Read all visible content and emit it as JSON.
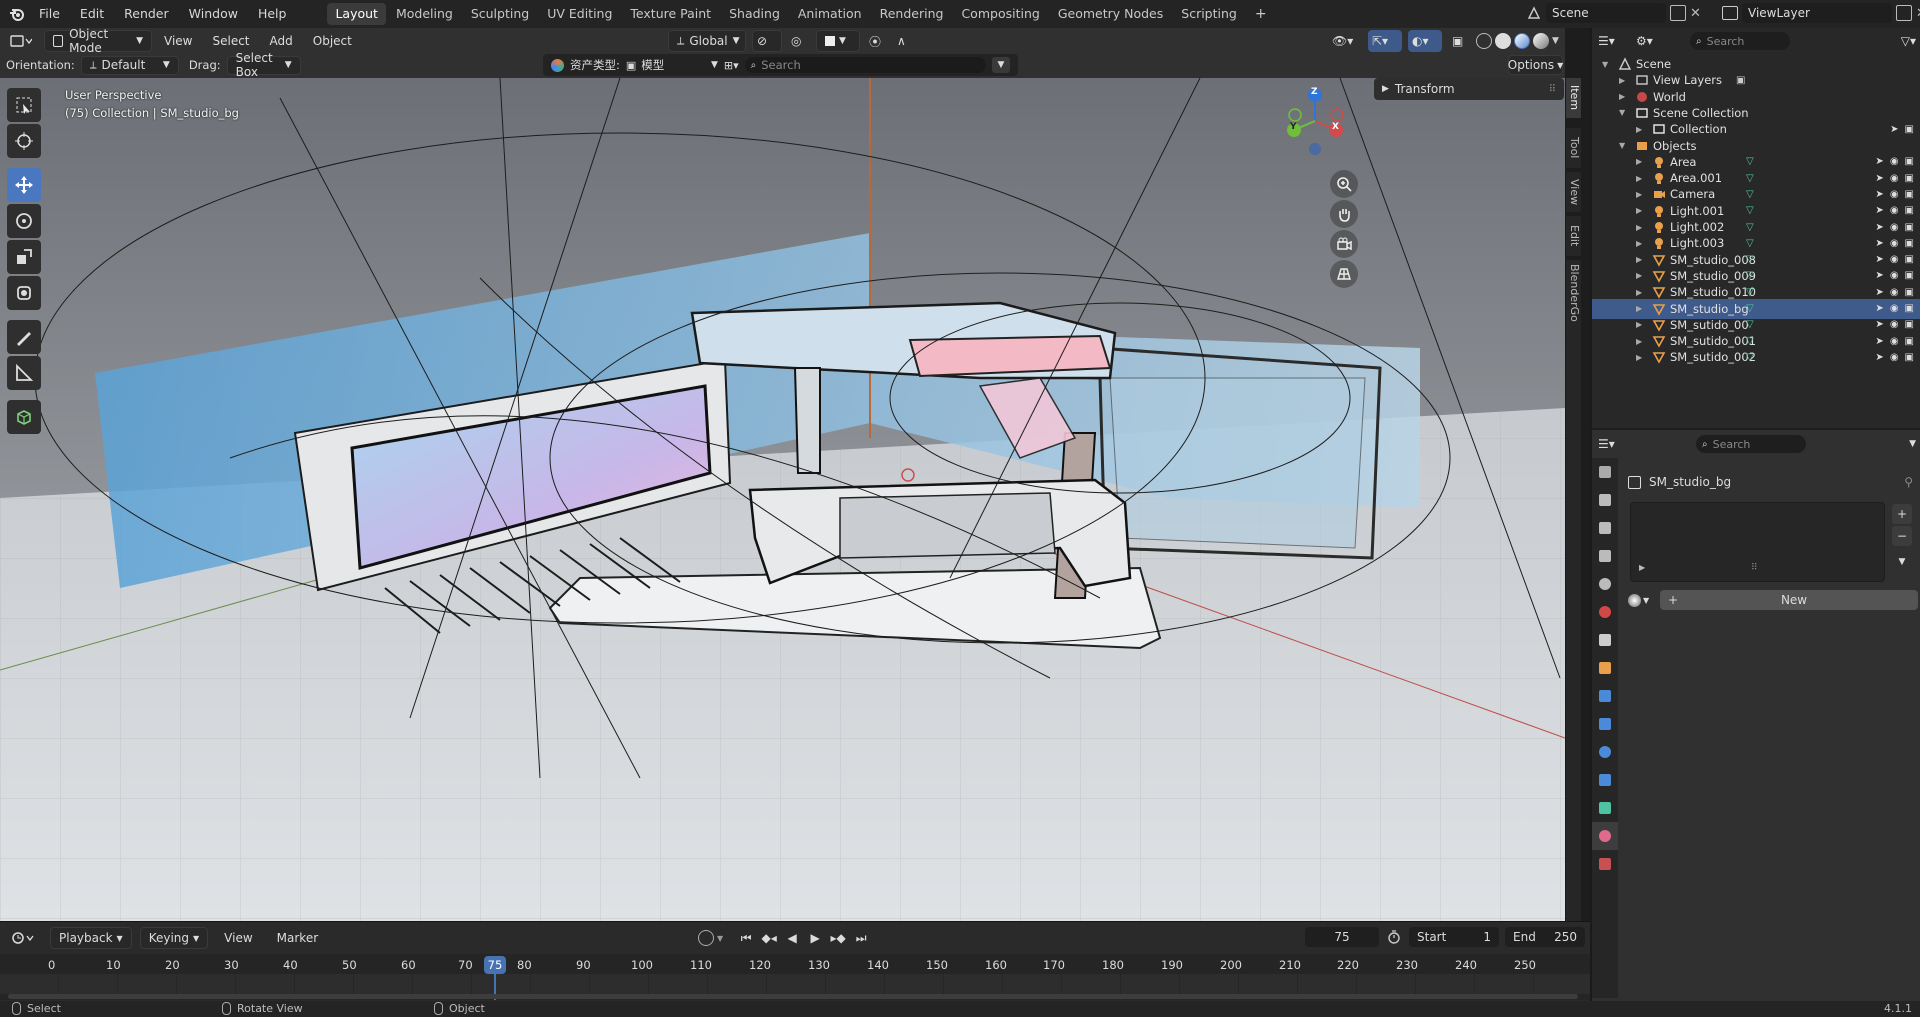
{
  "app": {
    "version": "4.1.1"
  },
  "menu": [
    "File",
    "Edit",
    "Render",
    "Window",
    "Help"
  ],
  "workspaces": [
    "Layout",
    "Modeling",
    "Sculpting",
    "UV Editing",
    "Texture Paint",
    "Shading",
    "Animation",
    "Rendering",
    "Compositing",
    "Geometry Nodes",
    "Scripting"
  ],
  "active_workspace": "Layout",
  "scene_selector": {
    "scene": "Scene",
    "view_layer": "ViewLayer"
  },
  "viewport_header": {
    "mode": "Object Mode",
    "menus": [
      "View",
      "Select",
      "Add",
      "Object"
    ],
    "transform_orientation": "Global",
    "orientation_label": "Orientation:",
    "orientation_value": "Default",
    "drag_label": "Drag:",
    "drag_value": "Select Box",
    "options_label": "Options",
    "asset_type_label": "资产类型:",
    "asset_type_value": "模型",
    "asset_search_placeholder": "Search"
  },
  "viewport": {
    "perspective_text": "User Perspective",
    "collection_text": "(75) Collection | SM_studio_bg",
    "transform_panel": "Transform",
    "gizmo_axes": [
      "X",
      "Y",
      "Z"
    ]
  },
  "sidebar_tabs": [
    "Item",
    "Tool",
    "View",
    "Edit",
    "BlenderGo"
  ],
  "timeline": {
    "menus": [
      "Playback",
      "Keying",
      "View",
      "Marker"
    ],
    "current_frame": "75",
    "start_label": "Start",
    "start_value": "1",
    "end_label": "End",
    "end_value": "250",
    "ruler": [
      "0",
      "10",
      "20",
      "30",
      "40",
      "50",
      "60",
      "70",
      "75",
      "80",
      "90",
      "100",
      "110",
      "120",
      "130",
      "140",
      "150",
      "160",
      "170",
      "180",
      "190",
      "200",
      "210",
      "220",
      "230",
      "240",
      "250"
    ]
  },
  "status_bar": {
    "select": "Select",
    "rotate": "Rotate View",
    "object": "Object",
    "version": "4.1.1"
  },
  "outliner": {
    "search_placeholder": "Search",
    "rows": [
      {
        "label": "Scene",
        "icon": "scene-icon",
        "depth": 0,
        "expanded": true
      },
      {
        "label": "View Layers",
        "icon": "view-layers-icon",
        "depth": 1,
        "expanded": false
      },
      {
        "label": "World",
        "icon": "world-icon",
        "depth": 1,
        "expanded": false
      },
      {
        "label": "Scene Collection",
        "icon": "collection-icon",
        "depth": 1,
        "expanded": true
      },
      {
        "label": "Collection",
        "icon": "collection-icon",
        "depth": 2,
        "expanded": false
      },
      {
        "label": "Objects",
        "icon": "objects-icon",
        "depth": 1,
        "expanded": true
      },
      {
        "label": "Area",
        "icon": "light-icon",
        "depth": 2
      },
      {
        "label": "Area.001",
        "icon": "light-icon",
        "depth": 2
      },
      {
        "label": "Camera",
        "icon": "camera-icon",
        "depth": 2
      },
      {
        "label": "Light.001",
        "icon": "light-icon",
        "depth": 2
      },
      {
        "label": "Light.002",
        "icon": "light-icon",
        "depth": 2
      },
      {
        "label": "Light.003",
        "icon": "light-icon",
        "depth": 2
      },
      {
        "label": "SM_studio_008",
        "icon": "mesh-icon",
        "depth": 2
      },
      {
        "label": "SM_studio_009",
        "icon": "mesh-icon",
        "depth": 2
      },
      {
        "label": "SM_studio_010",
        "icon": "mesh-icon",
        "depth": 2
      },
      {
        "label": "SM_studio_bg",
        "icon": "mesh-icon",
        "depth": 2,
        "selected": true
      },
      {
        "label": "SM_sutido_00",
        "icon": "mesh-icon",
        "depth": 2
      },
      {
        "label": "SM_sutido_001",
        "icon": "mesh-icon",
        "depth": 2
      },
      {
        "label": "SM_sutido_002",
        "icon": "mesh-icon",
        "depth": 2
      }
    ]
  },
  "properties": {
    "search_placeholder": "Search",
    "object_name": "SM_studio_bg",
    "new_button": "New"
  },
  "colors": {
    "accent": "#4772b3",
    "selected_row": "#3f5b8c",
    "mesh": "#e9a04a",
    "green_icon": "#4fc3a1"
  }
}
